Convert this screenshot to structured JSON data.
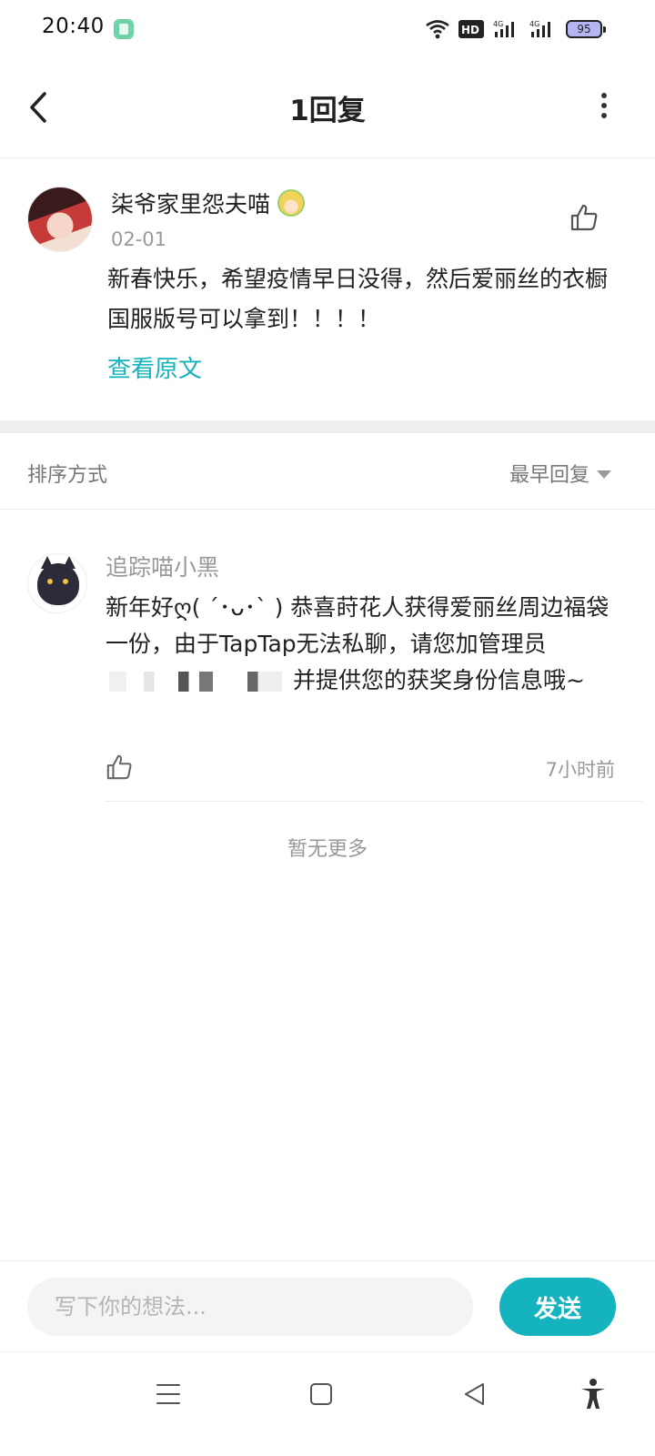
{
  "status_bar": {
    "time": "20:40",
    "battery": "95",
    "icons": [
      "app-notification-icon",
      "wifi-icon",
      "hd-icon",
      "signal-4g-icon",
      "signal-4g-icon",
      "battery-icon"
    ]
  },
  "header": {
    "title": "1回复",
    "back_icon": "back-icon",
    "more_icon": "more-vertical-icon"
  },
  "main_comment": {
    "author": "柒爷家里怨夫喵",
    "date": "02-01",
    "text": "新春快乐，希望疫情早日没得，然后爱丽丝的衣橱国服版号可以拿到！！！！",
    "view_original": "查看原文"
  },
  "sort": {
    "label": "排序方式",
    "value": "最早回复"
  },
  "reply": {
    "author": "追踪喵小黑",
    "text_before": "新年好ღ( ´･ᴗ･` ) 恭喜莳花人获得爱丽丝周边福袋一份，由于TapTap无法私聊，请您加管理员",
    "text_after": "并提供您的获奖身份信息哦~",
    "time": "7小时前"
  },
  "footer_note": "暂无更多",
  "composer": {
    "placeholder": "写下你的想法...",
    "send_label": "发送"
  },
  "colors": {
    "accent": "#15b3bd",
    "divider": "#eeeeee",
    "muted_text": "#999999"
  }
}
